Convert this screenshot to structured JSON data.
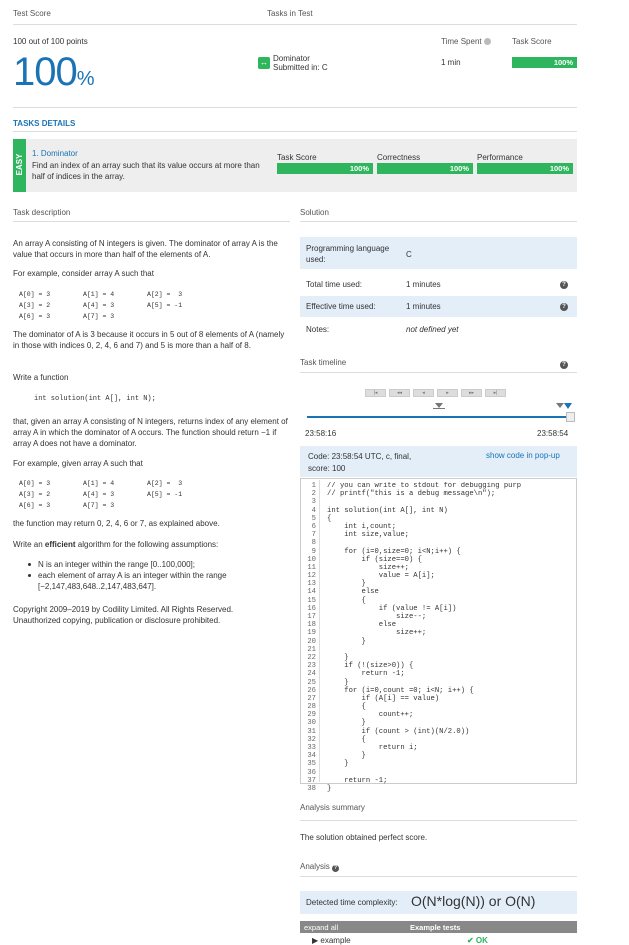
{
  "header": {
    "test_score_label": "Test Score",
    "tasks_in_test_label": "Tasks in Test",
    "points": "100 out of 100 points",
    "score": "100",
    "score_unit": "%",
    "task_name": "Dominator",
    "submitted": "Submitted in: C",
    "time_spent_label": "Time Spent",
    "task_score_label": "Task Score",
    "time_spent_value": "1 min",
    "task_score_value": "100%",
    "task_score_fraction": 1.0
  },
  "tasks_details": {
    "title": "TASKS DETAILS",
    "difficulty": "EASY",
    "task_title": "1. Dominator",
    "task_desc": "Find an index of an array such that its value occurs at more than half of indices in the array.",
    "score_labels": [
      "Task Score",
      "Correctness",
      "Performance"
    ],
    "score_values": [
      "100%",
      "100%",
      "100%"
    ]
  },
  "description": {
    "title": "Task description",
    "p1": "An array A consisting of N integers is given. The dominator of array A is the value that occurs in more than half of the elements of A.",
    "p2": "For example, consider array A such that",
    "arr1": [
      "A[0] = 3",
      "A[1] = 4",
      "A[2] =  3",
      "A[3] = 2",
      "A[4] = 3",
      "A[5] = -1",
      "A[6] = 3",
      "A[7] = 3"
    ],
    "p3": "The dominator of A is 3 because it occurs in 5 out of 8 elements of A (namely in those with indices 0, 2, 4, 6 and 7) and 5 is more than a half of 8.",
    "p4": "Write a function",
    "signature": "int solution(int A[], int N);",
    "p5": "that, given an array A consisting of N integers, returns index of any element of array A in which the dominator of A occurs. The function should return −1 if array A does not have a dominator.",
    "p6": "For example, given array A such that",
    "arr2": [
      "A[0] = 3",
      "A[1] = 4",
      "A[2] =  3",
      "A[3] = 2",
      "A[4] = 3",
      "A[5] = -1",
      "A[6] = 3",
      "A[7] = 3"
    ],
    "p7": "the function may return 0, 2, 4, 6 or 7, as explained above.",
    "p8_pre": "Write an ",
    "p8_bold": "efficient",
    "p8_post": " algorithm for the following assumptions:",
    "bullets": [
      "N is an integer within the range [0..100,000];",
      "each element of array A is an integer within the range [−2,147,483,648..2,147,483,647]."
    ],
    "copyright1": "Copyright 2009–2019 by Codility Limited. All Rights Reserved.",
    "copyright2": "Unauthorized copying, publication or disclosure prohibited."
  },
  "solution": {
    "title": "Solution",
    "lang_label": "Programming language used:",
    "lang_value": "C",
    "total_time_label": "Total time used:",
    "total_time_value": "1 minutes",
    "effective_time_label": "Effective time used:",
    "effective_time_value": "1 minutes",
    "notes_label": "Notes:",
    "notes_value": "not defined yet",
    "timeline_title": "Task timeline",
    "time_start": "23:58:16",
    "time_end": "23:58:54",
    "code_meta": "Code: 23:58:54 UTC, c, final,",
    "code_score": "score:  100",
    "popup_link": "show code in pop-up",
    "code_lines": [
      "// you can write to stdout for debugging purp",
      "// printf(\"this is a debug message\\n\");",
      "",
      "int solution(int A[], int N)",
      "{",
      "    int i,count;",
      "    int size,value;",
      "",
      "    for (i=0,size=0; i<N;i++) {",
      "        if (size==0) {",
      "            size++;",
      "            value = A[i];",
      "        }",
      "        else",
      "        {",
      "            if (value != A[i])",
      "                size--;",
      "            else",
      "                size++;",
      "        }",
      "",
      "    }",
      "    if (!(size>0)) {",
      "        return -1;",
      "    }",
      "    for (i=0,count =0; i<N; i++) {",
      "        if (A[i] == value)",
      "        {",
      "            count++;",
      "        }",
      "        if (count > (int)(N/2.0))",
      "        {",
      "            return i;",
      "        }",
      "    }",
      "",
      "    return -1;",
      "}"
    ],
    "analysis_summary_title": "Analysis summary",
    "analysis_summary_text": "The solution obtained perfect score.",
    "analysis_title": "Analysis",
    "complexity_label": "Detected time complexity:",
    "complexity_value": "O(N*log(N)) or O(N)",
    "expand_all": "expand all",
    "example_tests": "Example tests",
    "example_name": "example",
    "example_result": "✔ OK"
  },
  "colors": {
    "accent": "#1a73b5",
    "green": "#2fb55d",
    "blue_bg": "#e3eef9"
  }
}
